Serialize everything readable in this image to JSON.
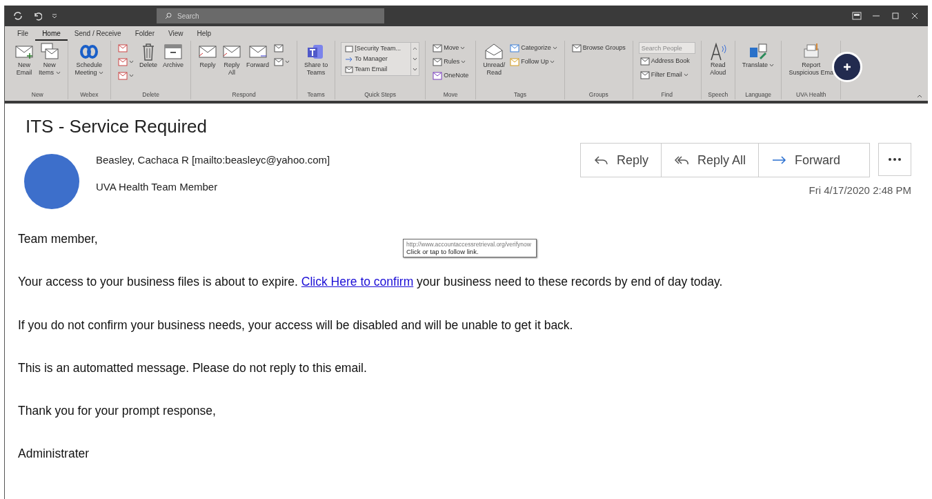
{
  "title_bar": {
    "search_placeholder": "Search"
  },
  "ribbon_tabs": [
    {
      "label": "File",
      "selected": false
    },
    {
      "label": "Home",
      "selected": true
    },
    {
      "label": "Send / Receive",
      "selected": false
    },
    {
      "label": "Folder",
      "selected": false
    },
    {
      "label": "View",
      "selected": false
    },
    {
      "label": "Help",
      "selected": false
    }
  ],
  "ribbon_groups": [
    {
      "label": "New",
      "columns": [
        [
          {
            "kind": "large",
            "lines": [
              "New",
              "Email"
            ],
            "dropdown": false
          }
        ],
        [
          {
            "kind": "large",
            "lines": [
              "New",
              "Items"
            ],
            "dropdown": true
          }
        ]
      ]
    },
    {
      "label": "Webex",
      "columns": [
        [
          {
            "kind": "large",
            "lines": [
              "Schedule",
              "Meeting"
            ],
            "dropdown": true
          }
        ]
      ]
    },
    {
      "label": "Delete",
      "columns": [
        [
          {
            "kind": "small",
            "dropdown": false
          },
          {
            "kind": "small",
            "dropdown": true
          },
          {
            "kind": "small",
            "dropdown": true
          }
        ],
        [
          {
            "kind": "large",
            "lines": [
              "Delete"
            ],
            "dropdown": false
          }
        ],
        [
          {
            "kind": "large",
            "lines": [
              "Archive"
            ],
            "dropdown": false
          }
        ]
      ]
    },
    {
      "label": "Respond",
      "columns": [
        [
          {
            "kind": "large",
            "lines": [
              "Reply"
            ],
            "dropdown": false
          }
        ],
        [
          {
            "kind": "large",
            "lines": [
              "Reply",
              "All"
            ],
            "dropdown": false
          }
        ],
        [
          {
            "kind": "large",
            "lines": [
              "Forward"
            ],
            "dropdown": false
          }
        ],
        [
          {
            "kind": "small",
            "dropdown": false
          },
          {
            "kind": "small",
            "dropdown": true
          }
        ]
      ]
    },
    {
      "label": "Teams",
      "columns": [
        [
          {
            "kind": "large",
            "lines": [
              "Share to",
              "Teams"
            ],
            "dropdown": false
          }
        ]
      ]
    },
    {
      "label": "Quick Steps",
      "columns": [
        [
          {
            "kind": "quicksteps",
            "entries": [
              "[Security Team...",
              "To Manager",
              "Team Email"
            ]
          }
        ]
      ]
    },
    {
      "label": "Move",
      "columns": [
        [
          {
            "kind": "small",
            "label": "Move",
            "dropdown": true
          },
          {
            "kind": "small",
            "label": "Rules",
            "dropdown": true
          },
          {
            "kind": "small",
            "label": "OneNote",
            "dropdown": false
          }
        ]
      ]
    },
    {
      "label": "Tags",
      "columns": [
        [
          {
            "kind": "large",
            "lines": [
              "Unread/",
              "Read"
            ],
            "dropdown": false
          }
        ],
        [
          {
            "kind": "small",
            "label": "Categorize",
            "dropdown": true
          },
          {
            "kind": "small",
            "label": "Follow Up",
            "dropdown": true
          }
        ]
      ]
    },
    {
      "label": "Groups",
      "columns": [
        [
          {
            "kind": "small",
            "label": "Browse Groups",
            "dropdown": false
          }
        ]
      ]
    },
    {
      "label": "Find",
      "columns": [
        [
          {
            "kind": "field",
            "placeholder": "Search People"
          },
          {
            "kind": "small",
            "label": "Address Book",
            "dropdown": false
          },
          {
            "kind": "small",
            "label": "Filter Email",
            "dropdown": true
          }
        ]
      ]
    },
    {
      "label": "Speech",
      "columns": [
        [
          {
            "kind": "large",
            "lines": [
              "Read",
              "Aloud"
            ],
            "dropdown": false
          }
        ]
      ]
    },
    {
      "label": "Language",
      "columns": [
        [
          {
            "kind": "large",
            "lines": [
              "Translate"
            ],
            "dropdown": true
          }
        ]
      ]
    },
    {
      "label": "UVA Health",
      "columns": [
        [
          {
            "kind": "large",
            "lines": [
              "Report",
              "Suspicious Ema"
            ],
            "dropdown": false
          }
        ]
      ]
    }
  ],
  "message": {
    "subject": "ITS - Service Required",
    "sender": "Beasley, Cachaca R [mailto:beasleyc@yahoo.com]",
    "sender_title": "UVA Health Team Member",
    "actions": [
      "Reply",
      "Reply All",
      "Forward"
    ],
    "date": "Fri 4/17/2020 2:48 PM",
    "tooltip": {
      "url": "http://www.accountaccessretrieval.org/verifynow",
      "hint": "Click or tap to follow link."
    },
    "paragraphs": [
      {
        "text": "Team member,"
      },
      {
        "before": "Your access to your business files is about to expire. ",
        "link": "Click Here to confirm",
        "after": " your business need to these records by end of day today."
      },
      {
        "text": "If you do not confirm your business needs, your access will be disabled and will be unable to get it back."
      },
      {
        "text": "This is an automatted message. Please do not reply to this email."
      },
      {
        "text": "Thank you for your prompt response,"
      },
      {
        "text": "Administrater"
      }
    ]
  }
}
